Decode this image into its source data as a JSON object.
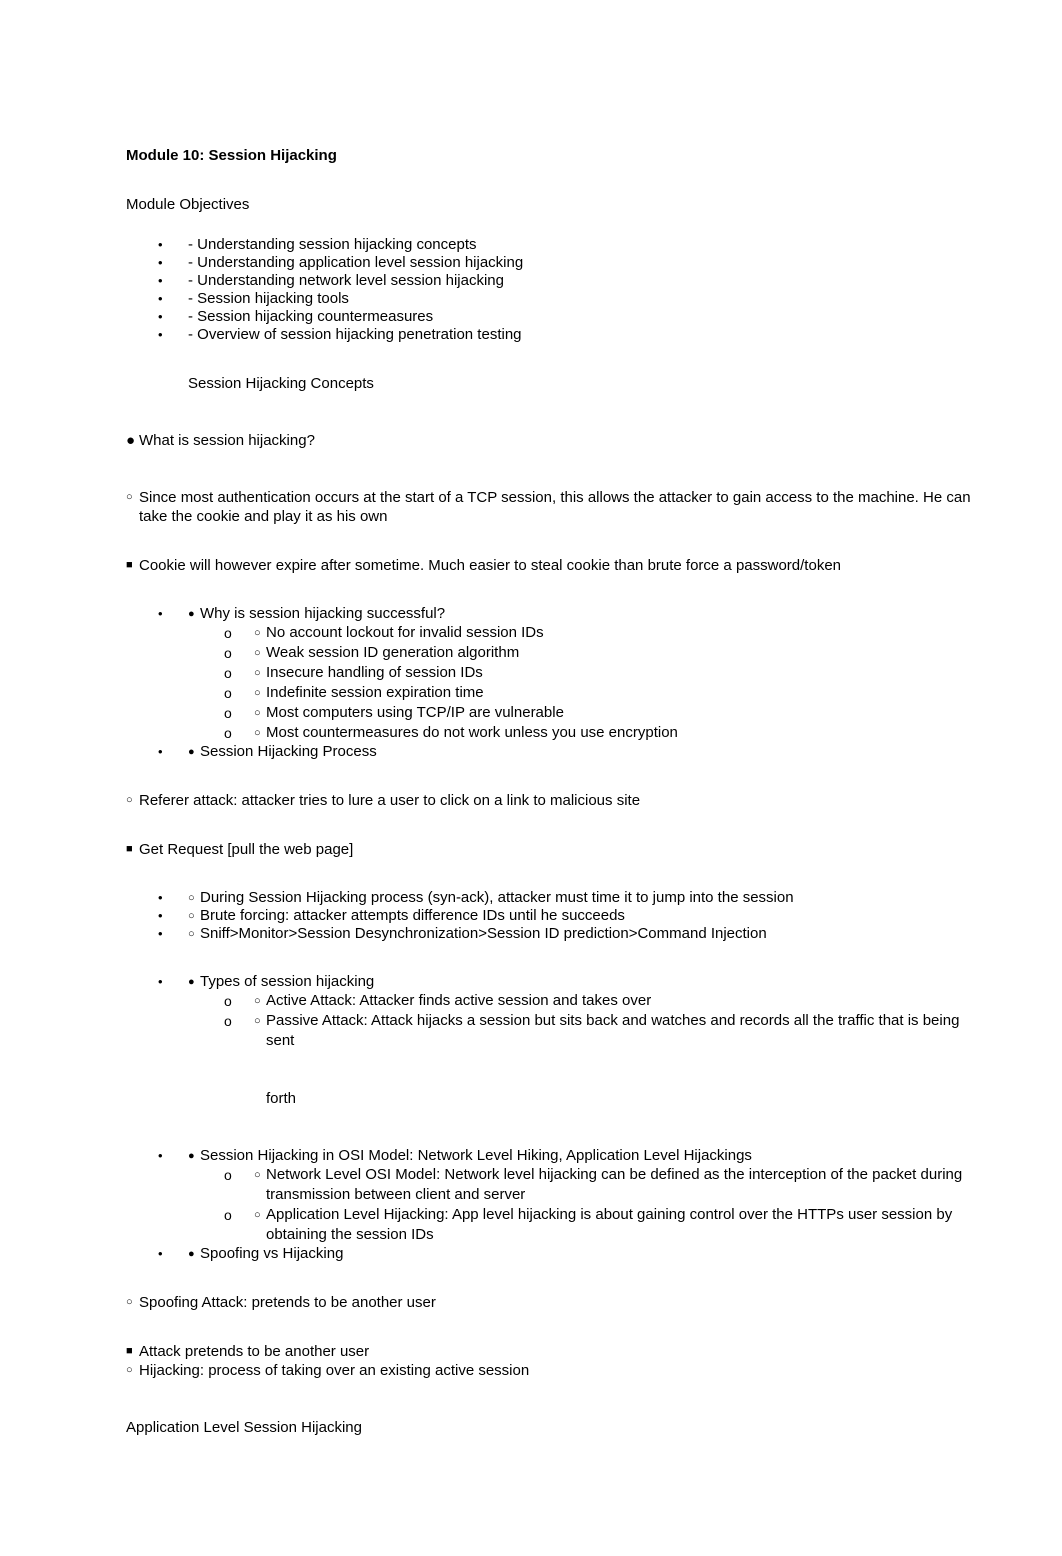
{
  "document": {
    "title": "Module 10: Session Hijacking",
    "objectives_heading": "Module Objectives",
    "objectives": [
      "- Understanding session hijacking concepts",
      "- Understanding application level session hijacking",
      "- Understanding network level session hijacking",
      "- Session hijacking tools",
      "- Session hijacking countermeasures",
      "- Overview of session hijacking penetration testing"
    ],
    "concepts_heading": "Session Hijacking Concepts",
    "what_is": {
      "mark": "●",
      "text": "What is session hijacking?"
    },
    "since_auth": {
      "mark": "○",
      "text": "Since most authentication occurs at the start of a TCP session, this allows the attacker to gain access to the machine. He can take the cookie and play it as his own"
    },
    "cookie_expire": {
      "mark": "■",
      "text": "Cookie will however expire after sometime. Much easier to steal cookie than brute force a password/token"
    },
    "why_successful": {
      "marker": "•",
      "inline_mark": "●",
      "text": "Why is session hijacking successful?",
      "reasons_marker": "o",
      "reasons_inline_mark": "○",
      "reasons": [
        "No account lockout for invalid session IDs",
        "Weak session ID generation algorithm",
        "Insecure handling of session IDs",
        "Indefinite session expiration time",
        "Most computers using TCP/IP are vulnerable",
        "Most countermeasures do not work unless you use encryption"
      ]
    },
    "hijacking_process": {
      "marker": "•",
      "inline_mark": "●",
      "text": "Session Hijacking Process"
    },
    "referer_attack": {
      "mark": "○",
      "text": "Referer attack: attacker tries to lure a user to click on a link to malicious site"
    },
    "get_request": {
      "mark": "■",
      "text": "Get Request [pull the web page]"
    },
    "process_steps": {
      "marker": "•",
      "inline_mark": "○",
      "items": [
        "During Session Hijacking process (syn-ack), attacker must time it to jump into the session",
        "Brute forcing: attacker attempts difference IDs until he succeeds",
        "Sniff>Monitor>Session Desynchronization>Session ID prediction>Command Injection"
      ]
    },
    "types": {
      "marker": "•",
      "inline_mark": "●",
      "text": "Types of session hijacking",
      "sub_marker": "o",
      "sub_inline_mark": "○",
      "items": [
        "Active Attack: Attacker finds active session and takes over",
        "Passive Attack: Attack hijacks a session but sits back and watches and records all the traffic that is being sent"
      ],
      "trailing_word": "forth"
    },
    "osi_model": {
      "marker": "•",
      "inline_mark": "●",
      "text": "Session Hijacking in OSI Model: Network Level Hiking, Application Level Hijackings",
      "sub_marker": "o",
      "sub_inline_mark": "○",
      "items": [
        "Network Level OSI Model: Network level hijacking can be defined as the interception of the packet during transmission between client and server",
        "Application Level Hijacking: App level hijacking is about gaining control over the HTTPs user session by obtaining the session IDs"
      ]
    },
    "spoofing_vs_hijacking": {
      "marker": "•",
      "inline_mark": "●",
      "text": "Spoofing vs Hijacking"
    },
    "spoofing_attack": {
      "mark": "○",
      "text": "Spoofing Attack: pretends to be another user"
    },
    "attack_pretends": {
      "mark": "■",
      "text": "Attack pretends to be another user"
    },
    "hijacking_def": {
      "mark": "○",
      "text": "Hijacking: process of taking over an existing active session"
    },
    "app_level_heading": "Application Level Session Hijacking"
  }
}
